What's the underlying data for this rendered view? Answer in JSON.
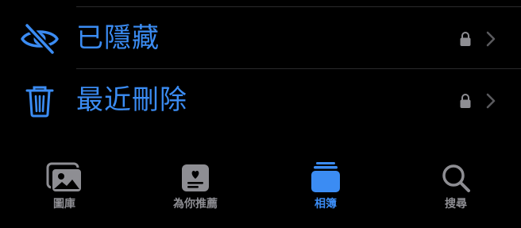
{
  "rows": [
    {
      "label": "已隱藏",
      "icon": "eye-slash-icon",
      "locked": true
    },
    {
      "label": "最近刪除",
      "icon": "trash-icon",
      "locked": true
    }
  ],
  "tabs": [
    {
      "label": "圖庫",
      "icon": "photo-library-icon",
      "active": false
    },
    {
      "label": "為你推薦",
      "icon": "for-you-icon",
      "active": false
    },
    {
      "label": "相簿",
      "icon": "albums-icon",
      "active": true
    },
    {
      "label": "搜尋",
      "icon": "magnifier-icon",
      "active": false
    }
  ],
  "colors": {
    "accent": "#3b8cf3",
    "inactive": "#8e8e93",
    "background": "#000000",
    "divider": "#2a2a2c"
  }
}
